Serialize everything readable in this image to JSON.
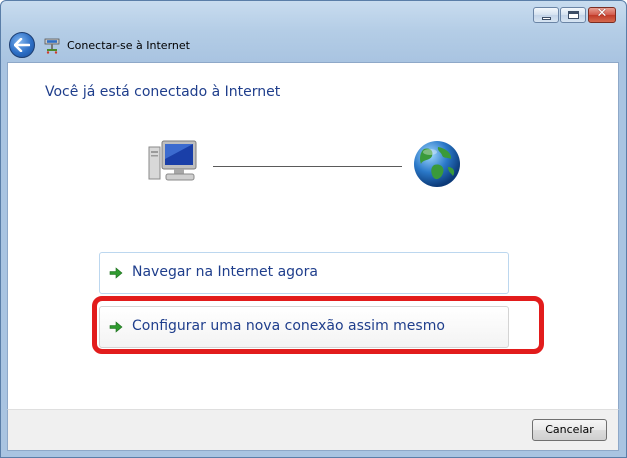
{
  "window": {
    "title": "Conectar-se à Internet",
    "controls": [
      "minimize-icon",
      "maximize-icon",
      "close-icon"
    ],
    "close_glyph": "✕"
  },
  "content": {
    "heading": "Você já está conectado à Internet",
    "icons": {
      "left": "computer-icon",
      "right": "globe-icon"
    },
    "options": [
      {
        "label": "Navegar na Internet agora",
        "icon": "green-arrow-icon"
      },
      {
        "label": "Configurar uma nova conexão assim mesmo",
        "icon": "green-arrow-icon",
        "highlighted": true
      }
    ],
    "highlight_color": "#e21c1c",
    "link_color": "#1f3e8c"
  },
  "footer": {
    "cancel_label": "Cancelar"
  }
}
